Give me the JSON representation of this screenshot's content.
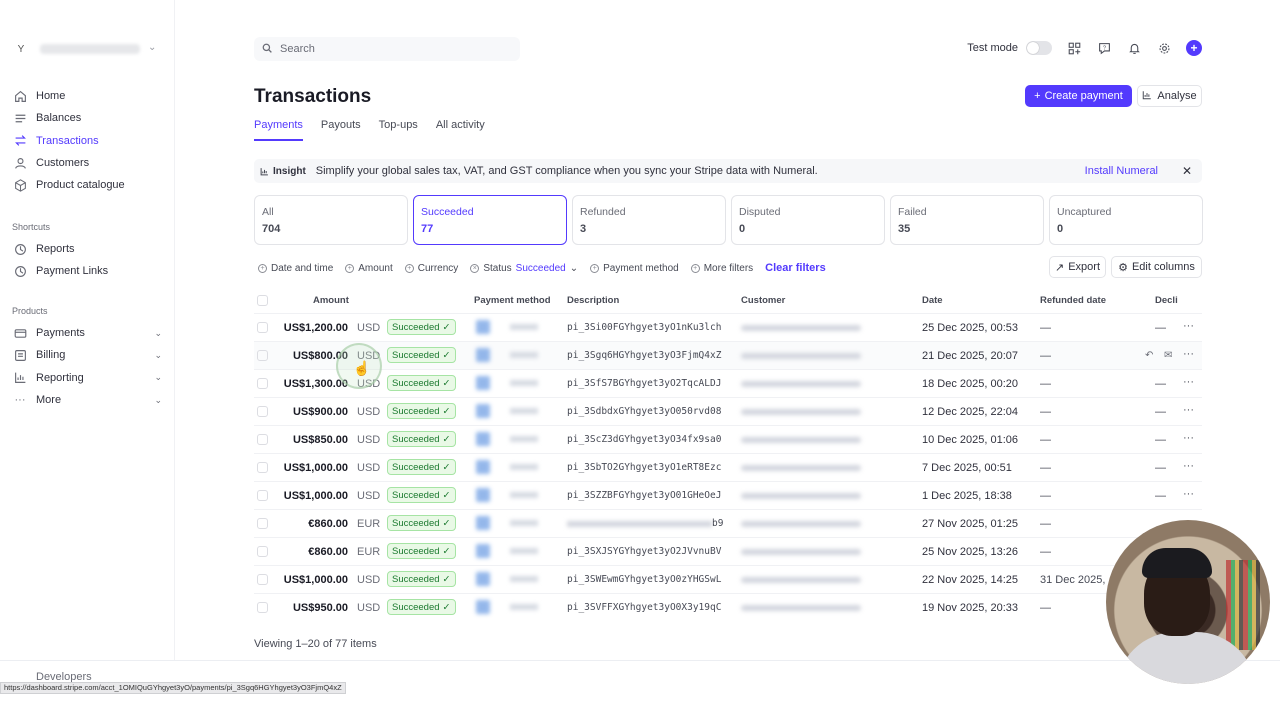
{
  "sidebar": {
    "account_initial": "Y",
    "nav": [
      {
        "label": "Home",
        "icon": "home-icon"
      },
      {
        "label": "Balances",
        "icon": "balances-icon"
      },
      {
        "label": "Transactions",
        "icon": "transactions-icon",
        "active": true
      },
      {
        "label": "Customers",
        "icon": "customers-icon"
      },
      {
        "label": "Product catalogue",
        "icon": "product-icon"
      }
    ],
    "shortcuts_title": "Shortcuts",
    "shortcuts": [
      {
        "label": "Reports",
        "icon": "clock-icon"
      },
      {
        "label": "Payment Links",
        "icon": "clock-icon"
      }
    ],
    "products_title": "Products",
    "products": [
      {
        "label": "Payments",
        "icon": "payments-icon"
      },
      {
        "label": "Billing",
        "icon": "billing-icon"
      },
      {
        "label": "Reporting",
        "icon": "reporting-icon"
      },
      {
        "label": "More",
        "icon": "more-icon"
      }
    ],
    "developers": "Developers"
  },
  "topbar": {
    "search_placeholder": "Search",
    "test_mode": "Test mode"
  },
  "page": {
    "title": "Transactions",
    "tabs": [
      "Payments",
      "Payouts",
      "Top-ups",
      "All activity"
    ],
    "create_payment": "Create payment",
    "analyse": "Analyse"
  },
  "banner": {
    "tag": "Insight",
    "message": "Simplify your global sales tax, VAT, and GST compliance when you sync your Stripe data with Numeral.",
    "link": "Install Numeral"
  },
  "status_cards": [
    {
      "label": "All",
      "count": "704"
    },
    {
      "label": "Succeeded",
      "count": "77",
      "active": true
    },
    {
      "label": "Refunded",
      "count": "3"
    },
    {
      "label": "Disputed",
      "count": "0"
    },
    {
      "label": "Failed",
      "count": "35"
    },
    {
      "label": "Uncaptured",
      "count": "0"
    }
  ],
  "filters": {
    "date": "Date and time",
    "amount": "Amount",
    "currency": "Currency",
    "status": "Status",
    "status_value": "Succeeded",
    "payment_method": "Payment method",
    "more": "More filters",
    "clear": "Clear filters",
    "export": "Export",
    "edit_columns": "Edit columns"
  },
  "table": {
    "headers": {
      "amount": "Amount",
      "payment_method": "Payment method",
      "description": "Description",
      "customer": "Customer",
      "date": "Date",
      "refunded_date": "Refunded date",
      "declined": "Decli"
    },
    "rows": [
      {
        "amount": "US$1,200.00",
        "currency": "USD",
        "status": "Succeeded",
        "desc": "pi_3Si00FGYhgyet3yO1nKu3lch",
        "date": "25 Dec 2025, 00:53",
        "refunded": "—"
      },
      {
        "amount": "US$800.00",
        "currency": "USD",
        "status": "Succeeded",
        "desc": "pi_3Sgq6HGYhgyet3yO3FjmQ4xZ",
        "date": "21 Dec 2025, 20:07",
        "refunded": "—"
      },
      {
        "amount": "US$1,300.00",
        "currency": "USD",
        "status": "Succeeded",
        "desc": "pi_3SfS7BGYhgyet3yO2TqcALDJ",
        "date": "18 Dec 2025, 00:20",
        "refunded": "—"
      },
      {
        "amount": "US$900.00",
        "currency": "USD",
        "status": "Succeeded",
        "desc": "pi_3SdbdxGYhgyet3yO050rvd08",
        "date": "12 Dec 2025, 22:04",
        "refunded": "—"
      },
      {
        "amount": "US$850.00",
        "currency": "USD",
        "status": "Succeeded",
        "desc": "pi_3ScZ3dGYhgyet3yO34fx9sa0",
        "date": "10 Dec 2025, 01:06",
        "refunded": "—"
      },
      {
        "amount": "US$1,000.00",
        "currency": "USD",
        "status": "Succeeded",
        "desc": "pi_3SbTO2GYhgyet3yO1eRT8Ezc",
        "date": "7 Dec 2025, 00:51",
        "refunded": "—"
      },
      {
        "amount": "US$1,000.00",
        "currency": "USD",
        "status": "Succeeded",
        "desc": "pi_3SZZBFGYhgyet3yO01GHeOeJ",
        "date": "1 Dec 2025, 18:38",
        "refunded": "—"
      },
      {
        "amount": "€860.00",
        "currency": "EUR",
        "status": "Succeeded",
        "desc": "b9",
        "date": "27 Nov 2025, 01:25",
        "refunded": "—"
      },
      {
        "amount": "€860.00",
        "currency": "EUR",
        "status": "Succeeded",
        "desc": "pi_3SXJSYGYhgyet3yO2JVvnuBV",
        "date": "25 Nov 2025, 13:26",
        "refunded": "—"
      },
      {
        "amount": "US$1,000.00",
        "currency": "USD",
        "status": "Succeeded",
        "desc": "pi_3SWEwmGYhgyet3yO0zYHGSwL",
        "date": "22 Nov 2025, 14:25",
        "refunded": "31 Dec 2025,"
      },
      {
        "amount": "US$950.00",
        "currency": "USD",
        "status": "Succeeded",
        "desc": "pi_3SVFFXGYhgyet3yO0X3y19qC",
        "date": "19 Nov 2025, 20:33",
        "refunded": "—"
      }
    ]
  },
  "footer": {
    "viewing": "Viewing 1–20 of 77 items"
  },
  "status_url": "https://dashboard.stripe.com/acct_1OMIQuGYhgyet3yO/payments/pi_3Sgq6HGYhgyet3yO3FjmQ4xZ",
  "colors": {
    "accent": "#533afd",
    "success_bg": "#e9f9e6",
    "success_text": "#1b7a2f"
  }
}
